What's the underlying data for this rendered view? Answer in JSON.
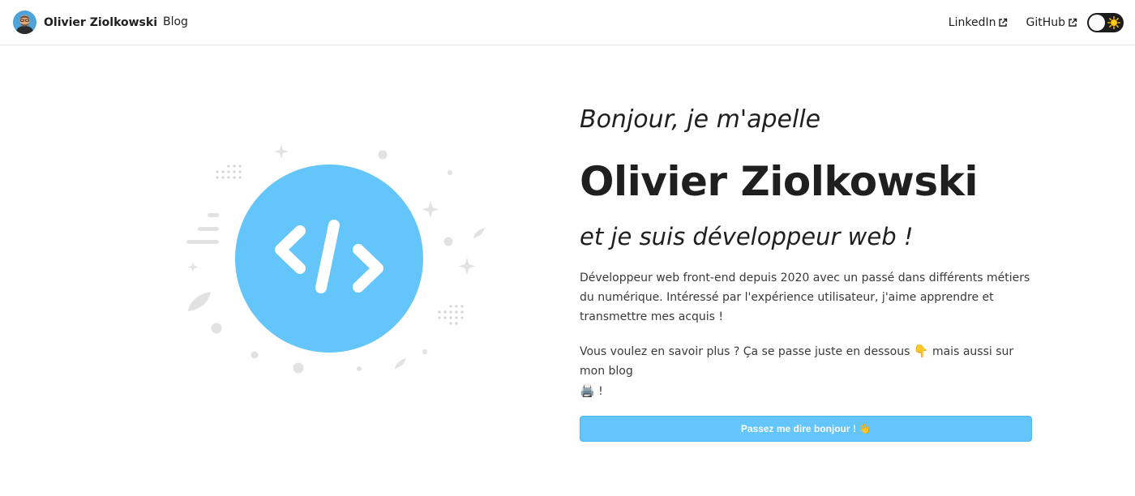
{
  "navbar": {
    "brand_name": "Olivier Ziolkowski",
    "blog_label": "Blog",
    "linkedin_label": "LinkedIn",
    "github_label": "GitHub",
    "theme_toggle": {
      "state": "light",
      "icon": "sun-icon"
    }
  },
  "hero": {
    "greeting": "Bonjour, je m'apelle",
    "name": "Olivier Ziolkowski",
    "subtitle": "et je suis développeur web !",
    "paragraph_1": "Développeur web front-end depuis 2020 avec un passé dans différents métiers du numérique. Intéressé par l'expérience utilisateur, j'aime apprendre et transmettre mes acquis !",
    "paragraph_2_text": "Vous voulez en savoir plus ? Ça se passe juste en dessous",
    "paragraph_2_emoji_1": "👇",
    "paragraph_2_middle": "mais aussi sur mon blog",
    "paragraph_2_emoji_2": "🖨️",
    "paragraph_2_end": "!",
    "cta_label": "Passez me dire bonjour ! 👋"
  },
  "colors": {
    "accent": "#63c5fa",
    "illustration_circle": "#63c5fa",
    "text": "#1f1f1f",
    "toggle_bg": "#1c1c1c"
  }
}
